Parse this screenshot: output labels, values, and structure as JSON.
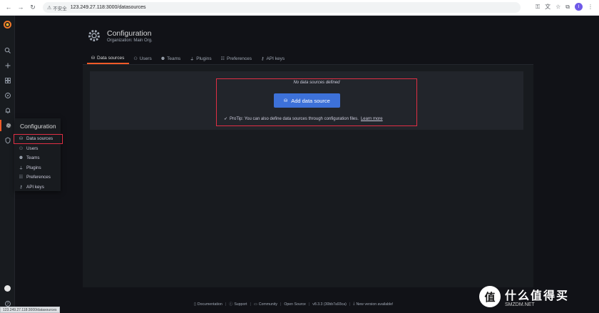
{
  "browser": {
    "url_warning": "不安全",
    "url": "123.249.27.118:3000/datasources",
    "profile_initial": "I"
  },
  "flyout": {
    "title": "Configuration",
    "items": [
      {
        "label": "Data sources",
        "icon": "database-icon"
      },
      {
        "label": "Users",
        "icon": "user-icon"
      },
      {
        "label": "Teams",
        "icon": "users-icon"
      },
      {
        "label": "Plugins",
        "icon": "plug-icon"
      },
      {
        "label": "Preferences",
        "icon": "sliders-icon"
      },
      {
        "label": "API keys",
        "icon": "key-icon"
      }
    ]
  },
  "header": {
    "title": "Configuration",
    "subtitle": "Organization: Main Org."
  },
  "tabs": [
    {
      "label": "Data sources",
      "active": true
    },
    {
      "label": "Users",
      "active": false
    },
    {
      "label": "Teams",
      "active": false
    },
    {
      "label": "Plugins",
      "active": false
    },
    {
      "label": "Preferences",
      "active": false
    },
    {
      "label": "API keys",
      "active": false
    }
  ],
  "empty": {
    "title": "No data sources defined",
    "button_label": "Add data source",
    "protip_text": "ProTip: You can also define data sources through configuration files.",
    "protip_link": "Learn more"
  },
  "footer": {
    "documentation": "Documentation",
    "support": "Support",
    "community": "Community",
    "open_source": "Open Source",
    "version": "v8.3.3 (30bb7a93ca)",
    "new_version": "New version available!"
  },
  "status_url": "123.249.27.118:3000/datasources",
  "watermark": {
    "cn": "什么值得买",
    "en": "SMZDM.NET"
  },
  "colors": {
    "accent": "#f05a28",
    "primary_button": "#3d71d9",
    "highlight": "#e02f44"
  }
}
